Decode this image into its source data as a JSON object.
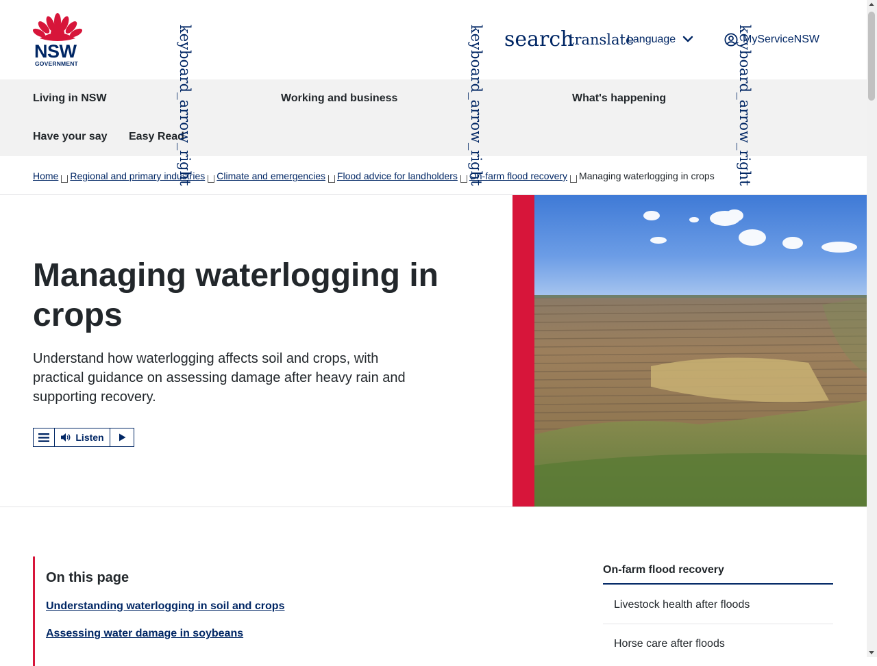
{
  "header": {
    "logo_text": "NSW",
    "logo_subtext": "GOVERNMENT",
    "search_icon_text": "search",
    "translate_icon_text": "translate",
    "language_label": "Language",
    "myservice_label": "MyServiceNSW",
    "arrow_icon_text": "keyboard_arrow_right"
  },
  "nav": {
    "items": [
      {
        "label": "Living in NSW"
      },
      {
        "label": "Working and business"
      },
      {
        "label": "What's happening"
      },
      {
        "label": "Have your say"
      },
      {
        "label": "Easy Read"
      }
    ]
  },
  "breadcrumb": {
    "items": [
      {
        "label": "Home"
      },
      {
        "label": "Regional and primary industries"
      },
      {
        "label": "Climate and emergencies"
      },
      {
        "label": "Flood advice for landholders"
      },
      {
        "label": "On-farm flood recovery"
      }
    ],
    "current": "Managing waterlogging in crops"
  },
  "hero": {
    "title": "Managing waterlogging in crops",
    "intro": "Understand how waterlogging affects soil and crops, with practical guidance on assessing damage after heavy rain and supporting recovery.",
    "listen_label": "Listen",
    "accent_color": "#d7153a"
  },
  "on_this_page": {
    "title": "On this page",
    "links": [
      {
        "label": "Understanding waterlogging in soil and crops"
      },
      {
        "label": "Assessing water damage in soybeans"
      }
    ]
  },
  "side_nav": {
    "title": "On-farm flood recovery",
    "items": [
      {
        "label": "Livestock health after floods"
      },
      {
        "label": "Horse care after floods"
      }
    ]
  },
  "colors": {
    "brand_navy": "#002664",
    "brand_red": "#d7153a",
    "nav_bg": "#f2f2f2"
  }
}
